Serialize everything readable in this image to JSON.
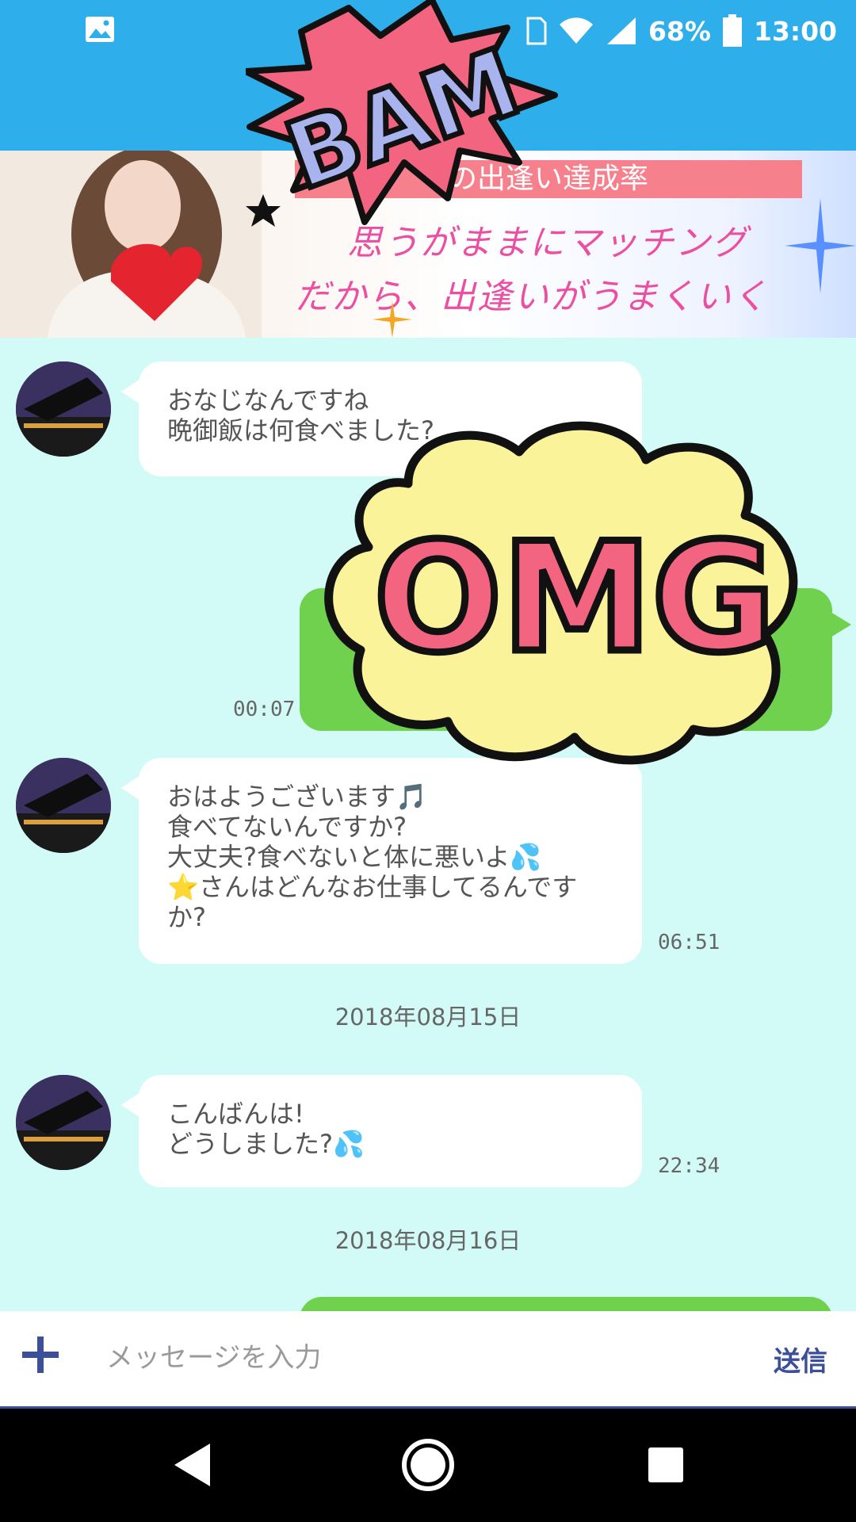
{
  "status_bar": {
    "battery": "68%",
    "time": "13:00",
    "icons": [
      "image-icon",
      "sim-icon",
      "wifi-icon",
      "signal-icon",
      "battery-icon"
    ]
  },
  "banner": {
    "line1": "の出逢い達成率",
    "line2": "思うがままにマッチング",
    "line3": "だから、出逢いがうまくいく"
  },
  "messages": [
    {
      "type": "in",
      "lines": [
        "おなじなんですね",
        "晩御飯は何食べました?"
      ],
      "time": ""
    },
    {
      "type": "out",
      "lines": [],
      "time": "00:07"
    },
    {
      "type": "in",
      "lines": [
        "おはようございます🎵",
        "食べてないんですか?",
        "大丈夫?食べないと体に悪いよ💦",
        "⭐さんはどんなお仕事してるんです",
        "か?"
      ],
      "time": "06:51"
    },
    {
      "type": "date",
      "text": "2018年08月15日"
    },
    {
      "type": "in",
      "lines": [
        "こんばんは!",
        "どうしました?💦"
      ],
      "time": "22:34"
    },
    {
      "type": "date",
      "text": "2018年08月16日"
    }
  ],
  "input": {
    "placeholder": "メッセージを入力",
    "send_label": "送信"
  },
  "stickers": {
    "bam_text": "BAM",
    "omg_text": "OMG"
  },
  "colors": {
    "header": "#2eaeea",
    "chat_bg": "#d2fbf7",
    "outgoing_bubble": "#6fd14e",
    "accent": "#3b4f9a",
    "banner_pink": "#ec4fa2"
  }
}
